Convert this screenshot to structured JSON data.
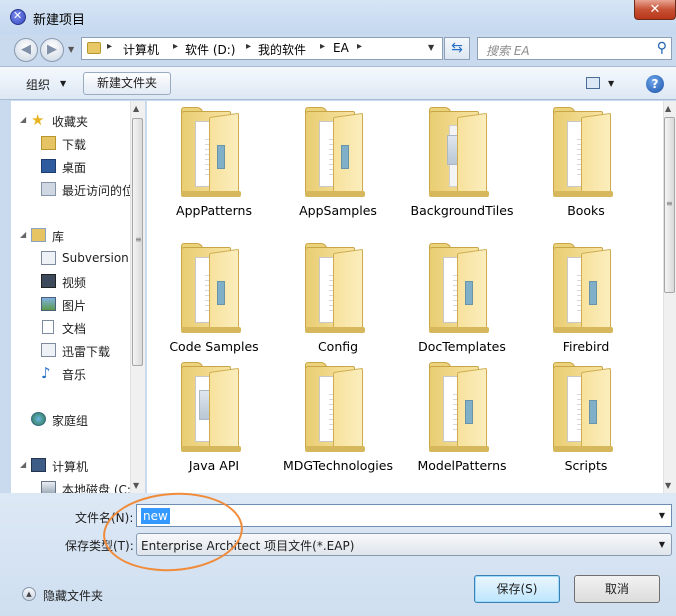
{
  "window": {
    "title": "新建项目",
    "close_glyph": "✕"
  },
  "navigation": {
    "breadcrumbs": [
      "计算机",
      "软件 (D:)",
      "我的软件",
      "EA"
    ],
    "search_placeholder": "搜索 EA"
  },
  "toolbar": {
    "organize_label": "组织",
    "new_folder_label": "新建文件夹",
    "help_glyph": "?"
  },
  "sidebar": {
    "items": [
      {
        "label": "收藏夹",
        "icon": "star-icon"
      },
      {
        "label": "下载",
        "icon": "download-folder-icon"
      },
      {
        "label": "桌面",
        "icon": "desktop-icon"
      },
      {
        "label": "最近访问的位置",
        "icon": "recent-places-icon"
      },
      {
        "label": "库",
        "icon": "library-icon"
      },
      {
        "label": "Subversion",
        "icon": "subversion-icon"
      },
      {
        "label": "视频",
        "icon": "video-library-icon"
      },
      {
        "label": "图片",
        "icon": "pictures-library-icon"
      },
      {
        "label": "文档",
        "icon": "documents-library-icon"
      },
      {
        "label": "迅雷下载",
        "icon": "xunlei-download-icon"
      },
      {
        "label": "音乐",
        "icon": "music-library-icon"
      },
      {
        "label": "家庭组",
        "icon": "homegroup-icon"
      },
      {
        "label": "计算机",
        "icon": "computer-icon"
      },
      {
        "label": "本地磁盘 (C:)",
        "icon": "local-disk-icon"
      }
    ]
  },
  "folders": [
    {
      "name": "AppPatterns"
    },
    {
      "name": "AppSamples"
    },
    {
      "name": "BackgroundTiles"
    },
    {
      "name": "Books"
    },
    {
      "name": "Code Samples"
    },
    {
      "name": "Config"
    },
    {
      "name": "DocTemplates"
    },
    {
      "name": "Firebird"
    },
    {
      "name": "Java API"
    },
    {
      "name": "MDGTechnologies"
    },
    {
      "name": "ModelPatterns"
    },
    {
      "name": "Scripts"
    }
  ],
  "form": {
    "filename_label": "文件名(N):",
    "filename_value": "new",
    "filetype_label": "保存类型(T):",
    "filetype_value": "Enterprise Architect 项目文件(*.EAP)"
  },
  "footer": {
    "hide_folders_label": "隐藏文件夹",
    "save_label": "保存(S)",
    "cancel_label": "取消"
  },
  "colors": {
    "annotation_oval": "#f08b3a",
    "selection": "#3399ff"
  }
}
